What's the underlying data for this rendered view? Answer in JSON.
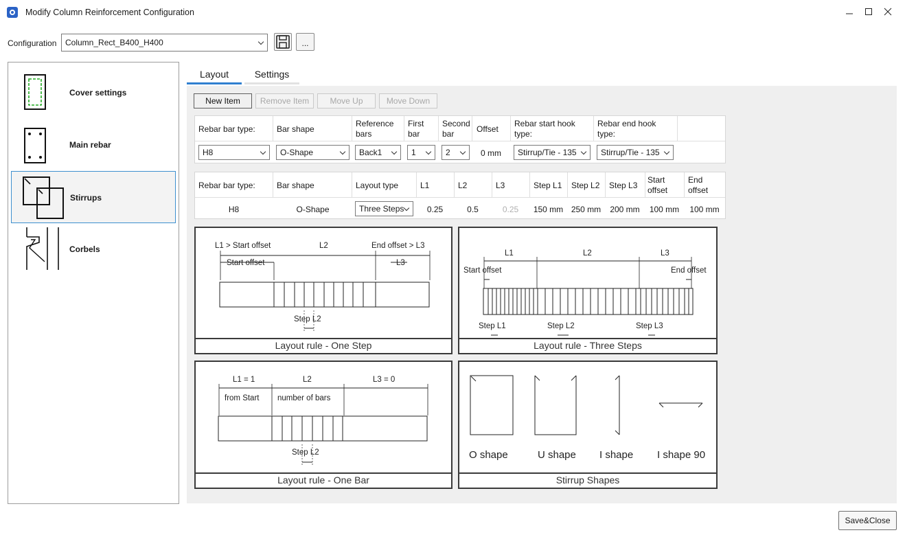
{
  "window": {
    "title": "Modify Column Reinforcement Configuration",
    "minimize_icon": "minimize-icon",
    "maximize_icon": "maximize-icon",
    "close_icon": "close-icon"
  },
  "config": {
    "label": "Configuration",
    "value": "Column_Rect_B400_H400",
    "more_label": "..."
  },
  "sidebar": {
    "items": [
      {
        "label": "Cover settings",
        "icon": "cover-settings-icon"
      },
      {
        "label": "Main rebar",
        "icon": "main-rebar-icon"
      },
      {
        "label": "Stirrups",
        "icon": "stirrups-icon",
        "selected": true
      },
      {
        "label": "Corbels",
        "icon": "corbels-icon"
      }
    ]
  },
  "tabs": [
    {
      "label": "Layout",
      "active": true
    },
    {
      "label": "Settings",
      "active": false
    }
  ],
  "toolbar": {
    "new_item": "New Item",
    "remove_item": "Remove Item",
    "move_up": "Move Up",
    "move_down": "Move Down"
  },
  "grid1": {
    "headers": {
      "bar_type": "Rebar bar type:",
      "bar_shape": "Bar shape",
      "reference_bars_1": "Reference",
      "reference_bars_2": "bars",
      "first_bar_1": "First",
      "first_bar_2": "bar",
      "second_bar_1": "Second",
      "second_bar_2": "bar",
      "offset": "Offset",
      "start_hook_1": "Rebar start hook",
      "start_hook_2": "type:",
      "end_hook_1": "Rebar end hook",
      "end_hook_2": "type:"
    },
    "row": {
      "bar_type": "H8",
      "bar_shape": "O-Shape",
      "reference_bars": "Back1",
      "first_bar": "1",
      "second_bar": "2",
      "offset": "0 mm",
      "start_hook": "Stirrup/Tie - 135",
      "end_hook": "Stirrup/Tie - 135"
    }
  },
  "grid2": {
    "headers": {
      "bar_type": "Rebar bar type:",
      "bar_shape": "Bar shape",
      "layout_type": "Layout type",
      "l1": "L1",
      "l2": "L2",
      "l3": "L3",
      "step_l1": "Step L1",
      "step_l2": "Step L2",
      "step_l3": "Step L3",
      "start_offset_1": "Start",
      "start_offset_2": "offset",
      "end_offset_1": "End",
      "end_offset_2": "offset"
    },
    "row": {
      "bar_type": "H8",
      "bar_shape": "O-Shape",
      "layout_type": "Three Steps",
      "l1": "0.25",
      "l2": "0.5",
      "l3": "0.25",
      "step_l1": "150 mm",
      "step_l2": "250 mm",
      "step_l3": "200 mm",
      "start_offset": "100 mm",
      "end_offset": "100 mm"
    }
  },
  "diagrams": {
    "one_step": {
      "caption": "Layout rule - One Step",
      "top_left": "L1 > Start offset",
      "top_mid": "L2",
      "top_right": "End offset > L3",
      "start_offset": "Start offset",
      "l3": "L3",
      "step": "Step L2"
    },
    "three_steps": {
      "caption": "Layout rule - Three Steps",
      "l1": "L1",
      "l2": "L2",
      "l3": "L3",
      "start_offset": "Start offset",
      "end_offset": "End offset",
      "step_l1": "Step L1",
      "step_l2": "Step L2",
      "step_l3": "Step L3"
    },
    "one_bar": {
      "caption": "Layout rule - One Bar",
      "l1": "L1 = 1",
      "l2": "L2",
      "l3": "L3 = 0",
      "from_start": "from Start",
      "number_of_bars": "number of bars",
      "step": "Step L2"
    },
    "stirrup_shapes": {
      "caption": "Stirrup Shapes",
      "o_shape": "O shape",
      "u_shape": "U shape",
      "i_shape": "I shape",
      "i_shape_90": "I shape 90"
    }
  },
  "footer": {
    "save_close": "Save&Close"
  }
}
